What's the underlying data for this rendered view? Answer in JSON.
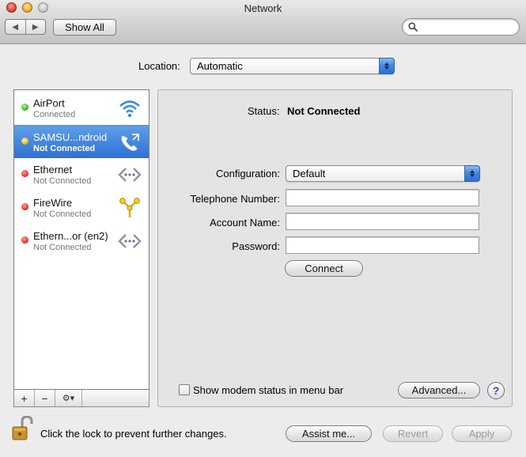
{
  "window": {
    "title": "Network"
  },
  "toolbar": {
    "back_glyph": "◀",
    "forward_glyph": "▶",
    "show_all_label": "Show All",
    "search_placeholder": ""
  },
  "location": {
    "label": "Location:",
    "value": "Automatic"
  },
  "services": [
    {
      "name": "AirPort",
      "status": "Connected",
      "status_color": "green",
      "icon": "wifi-icon",
      "selected": false
    },
    {
      "name": "SAMSU...ndroid",
      "status": "Not Connected",
      "status_color": "yellow",
      "icon": "telephone-icon",
      "selected": true
    },
    {
      "name": "Ethernet",
      "status": "Not Connected",
      "status_color": "red",
      "icon": "ethernet-icon",
      "selected": false
    },
    {
      "name": "FireWire",
      "status": "Not Connected",
      "status_color": "red",
      "icon": "firewire-icon",
      "selected": false
    },
    {
      "name": "Ethern...or (en2)",
      "status": "Not Connected",
      "status_color": "red",
      "icon": "ethernet-icon",
      "selected": false
    }
  ],
  "list_toolbar": {
    "add": "+",
    "remove": "−",
    "actions": "⚙▾"
  },
  "detail": {
    "status_label": "Status:",
    "status_value": "Not Connected",
    "configuration_label": "Configuration:",
    "configuration_value": "Default",
    "telephone_label": "Telephone Number:",
    "telephone_value": "",
    "account_label": "Account Name:",
    "account_value": "",
    "password_label": "Password:",
    "password_value": "",
    "connect_label": "Connect",
    "modem_status_label": "Show modem status in menu bar",
    "modem_status_checked": false,
    "advanced_label": "Advanced...",
    "help_label": "?"
  },
  "footer": {
    "lock_text": "Click the lock to prevent further changes.",
    "assist_label": "Assist me...",
    "revert_label": "Revert",
    "apply_label": "Apply"
  },
  "colors": {
    "selection": "#3a7ad9",
    "status_green": "#39b31f",
    "status_yellow": "#e8b51a",
    "status_red": "#dd2c22",
    "help_glyph": "#5b2fbf"
  }
}
